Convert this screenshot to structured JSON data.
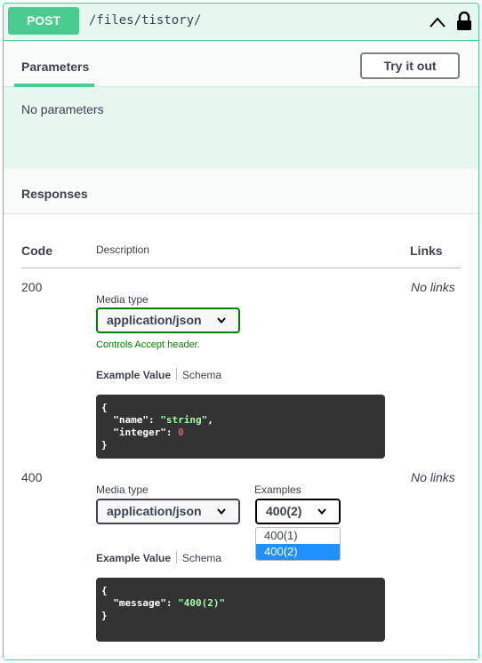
{
  "summary": {
    "method": "POST",
    "path": "/files/tistory/"
  },
  "parameters": {
    "tab_label": "Parameters",
    "try_button": "Try it out",
    "empty_text": "No parameters"
  },
  "responses": {
    "title": "Responses",
    "columns": {
      "code": "Code",
      "description": "Description",
      "links": "Links"
    },
    "rows": [
      {
        "code": "200",
        "links": "No links",
        "media_type_label": "Media type",
        "media_type": "application/json",
        "controls_hint": "Controls Accept header.",
        "example_tab": "Example Value",
        "schema_tab": "Schema",
        "example_lines": [
          "{",
          "  \"name\": \"string\",",
          "  \"integer\": 0",
          "}"
        ]
      },
      {
        "code": "400",
        "links": "No links",
        "media_type_label": "Media type",
        "media_type": "application/json",
        "examples_label": "Examples",
        "examples_value": "400(2)",
        "examples_options": [
          "400(1)",
          "400(2)"
        ],
        "example_tab": "Example Value",
        "schema_tab": "Schema",
        "example_lines": [
          "{",
          "  \"message\": \"400(2)\"",
          "}"
        ]
      }
    ]
  },
  "colors": {
    "post_green": "#49cc90",
    "block_bg": "#e8f6f0",
    "code_bg": "#333333",
    "string_green": "#a2fca2",
    "number_red": "#d36363",
    "select_blue": "#1e90ff"
  },
  "icons": [
    "chevron-up-icon",
    "lock-icon",
    "chevron-down-icon"
  ]
}
